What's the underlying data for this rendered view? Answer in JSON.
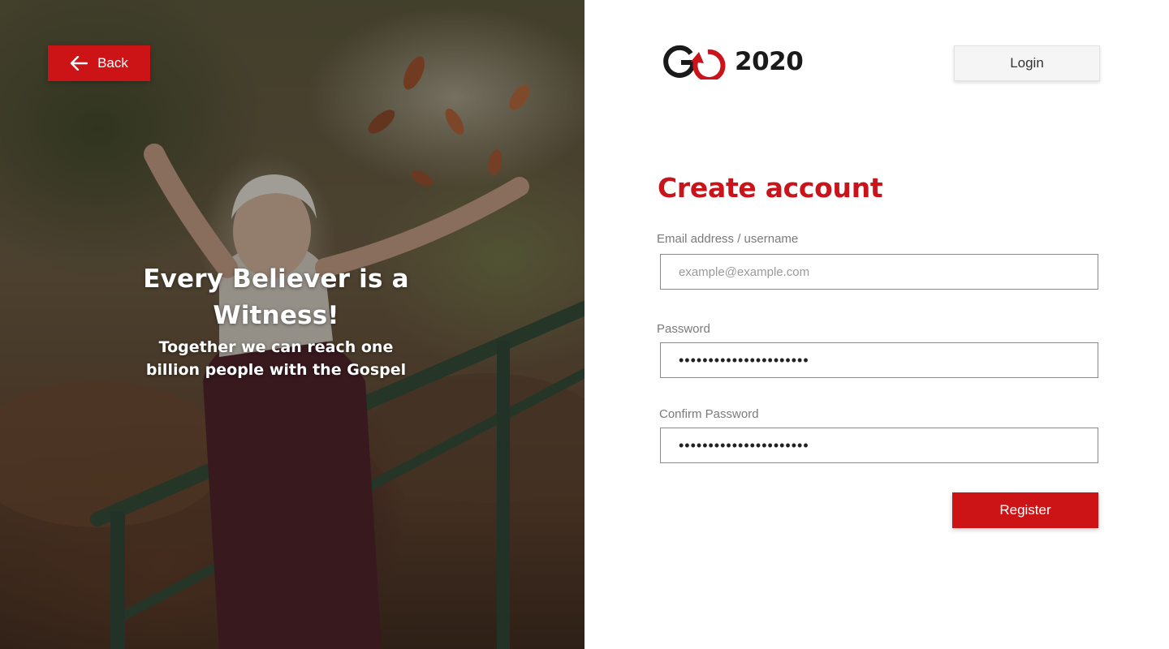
{
  "hero": {
    "back_label": "Back",
    "title": "Every Believer is a Witness!",
    "subtitle": "Together we can reach one billion people with the Gospel"
  },
  "header": {
    "logo_text": "2020",
    "login_label": "Login"
  },
  "form": {
    "title": "Create account",
    "email_label": "Email address / username",
    "email_placeholder": "example@example.com",
    "email_value": "",
    "password_label": "Password",
    "password_value": "••••••••••••••••••••••",
    "confirm_label": "Confirm Password",
    "confirm_value": "••••••••••••••••••••••",
    "register_label": "Register"
  },
  "colors": {
    "brand_red": "#cc1417",
    "title_red": "#c8141a"
  },
  "icons": {
    "back": "arrow-left-icon",
    "logo_mark": "go-logo-arrow-icon"
  }
}
